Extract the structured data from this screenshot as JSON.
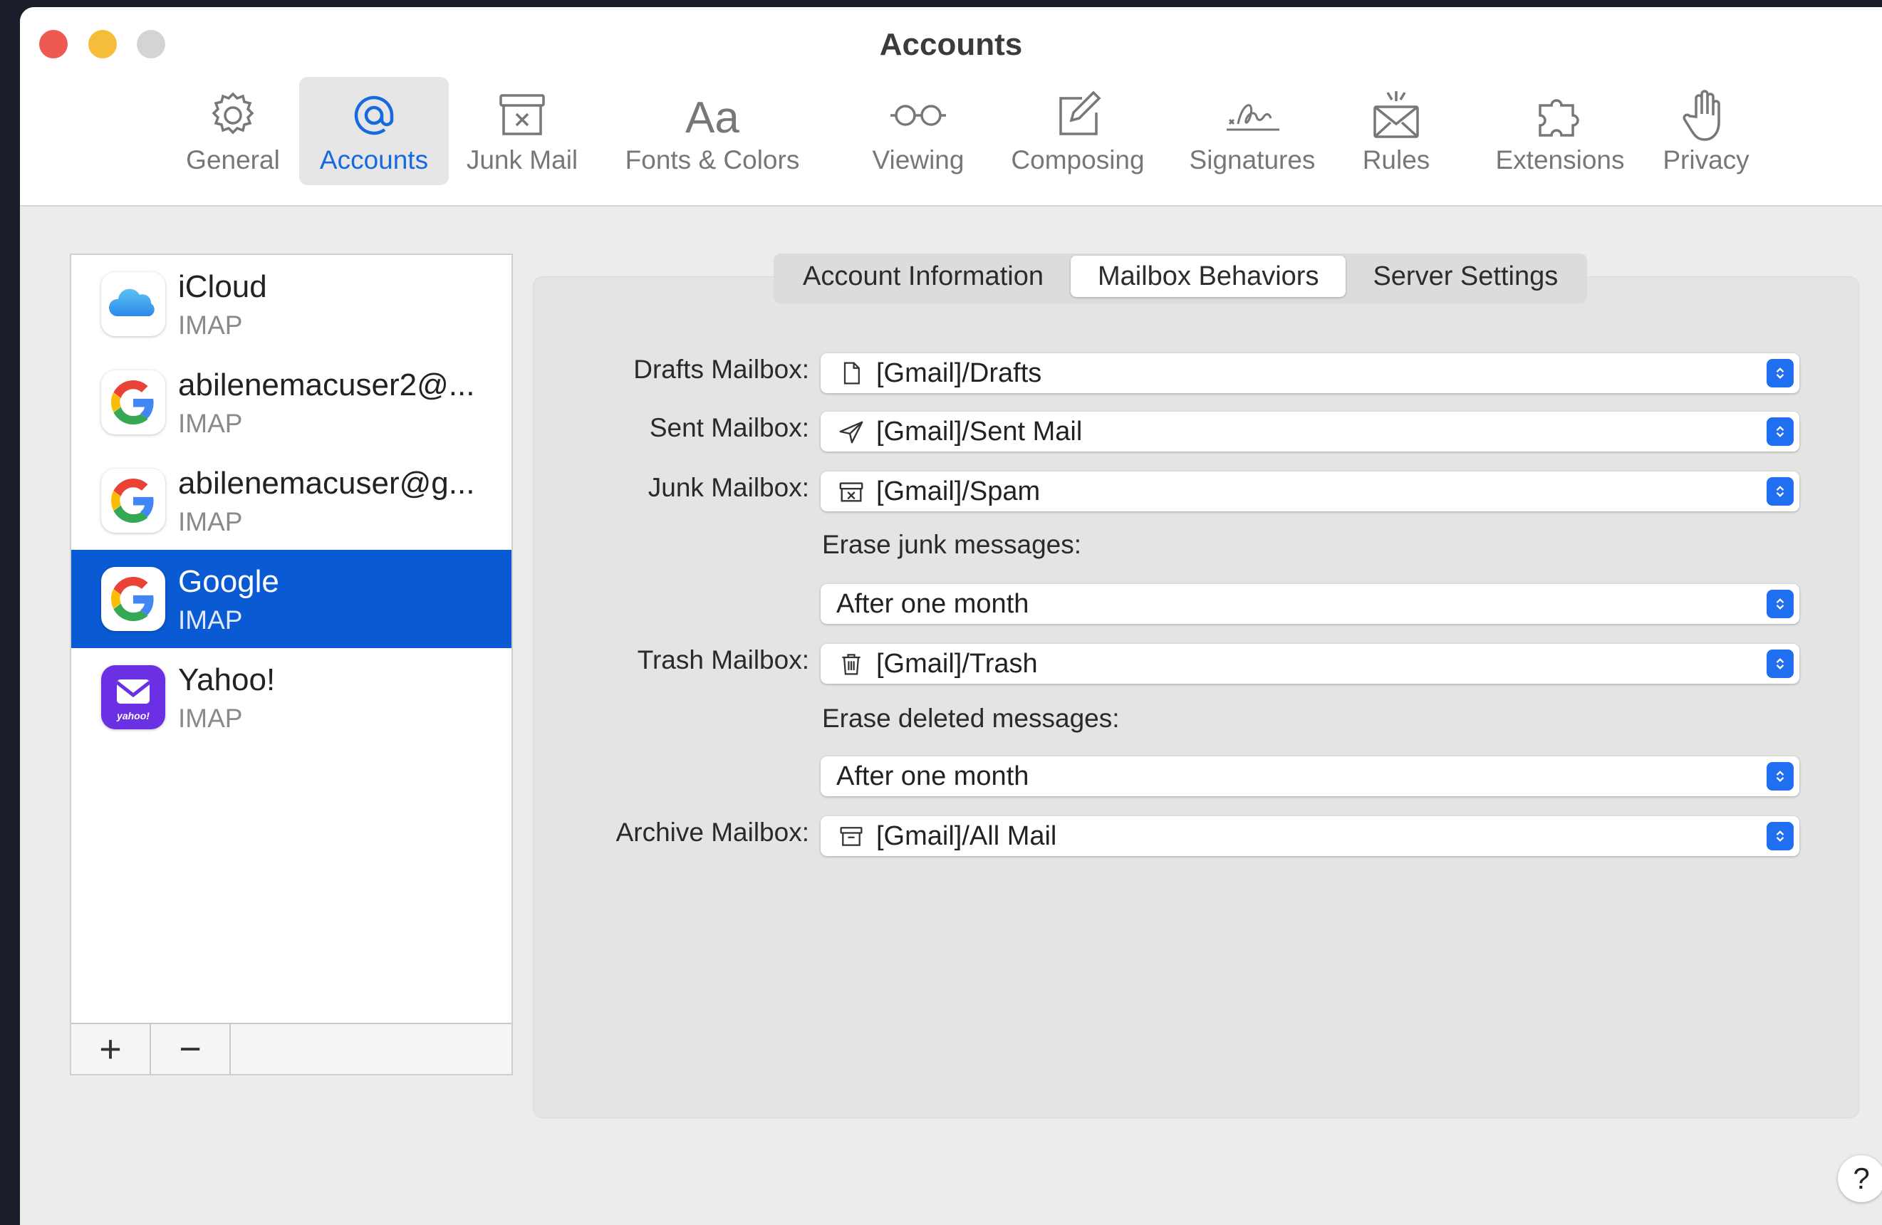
{
  "window": {
    "title": "Accounts"
  },
  "toolbar": {
    "items": [
      {
        "label": "General",
        "icon": "gear-icon"
      },
      {
        "label": "Accounts",
        "icon": "at-icon"
      },
      {
        "label": "Junk Mail",
        "icon": "junk-tray-icon"
      },
      {
        "label": "Fonts & Colors",
        "icon": "font-aa-icon"
      },
      {
        "label": "Viewing",
        "icon": "glasses-icon"
      },
      {
        "label": "Composing",
        "icon": "compose-icon"
      },
      {
        "label": "Signatures",
        "icon": "signature-icon"
      },
      {
        "label": "Rules",
        "icon": "rules-envelope-icon"
      },
      {
        "label": "Extensions",
        "icon": "puzzle-icon"
      },
      {
        "label": "Privacy",
        "icon": "hand-icon"
      }
    ],
    "active": "Accounts"
  },
  "accounts": [
    {
      "name": "iCloud",
      "type": "IMAP",
      "icon": "icloud-icon"
    },
    {
      "name": "abilenemacuser2@...",
      "type": "IMAP",
      "icon": "google-icon"
    },
    {
      "name": "abilenemacuser@g...",
      "type": "IMAP",
      "icon": "google-icon"
    },
    {
      "name": "Google",
      "type": "IMAP",
      "icon": "google-icon",
      "selected": true
    },
    {
      "name": "Yahoo!",
      "type": "IMAP",
      "icon": "yahoo-icon",
      "badge": "yahoo!"
    }
  ],
  "list_footer": {
    "add": "+",
    "remove": "−"
  },
  "tabs": [
    "Account Information",
    "Mailbox Behaviors",
    "Server Settings"
  ],
  "active_tab": "Mailbox Behaviors",
  "form": {
    "drafts": {
      "label": "Drafts Mailbox:",
      "value": "[Gmail]/Drafts",
      "icon": "document-icon"
    },
    "sent": {
      "label": "Sent Mailbox:",
      "value": "[Gmail]/Sent Mail",
      "icon": "paperplane-icon"
    },
    "junk": {
      "label": "Junk Mailbox:",
      "value": "[Gmail]/Spam",
      "icon": "junk-box-icon"
    },
    "erase_junk": {
      "label": "Erase junk messages:",
      "value": "After one month"
    },
    "trash": {
      "label": "Trash Mailbox:",
      "value": "[Gmail]/Trash",
      "icon": "trash-icon"
    },
    "erase_deleted": {
      "label": "Erase deleted messages:",
      "value": "After one month"
    },
    "archive": {
      "label": "Archive Mailbox:",
      "value": "[Gmail]/All Mail",
      "icon": "archive-box-icon"
    }
  },
  "help": "?",
  "colors": {
    "accent": "#1769e0",
    "selection": "#0a5ad4",
    "stepper": "#1f6ff0"
  }
}
